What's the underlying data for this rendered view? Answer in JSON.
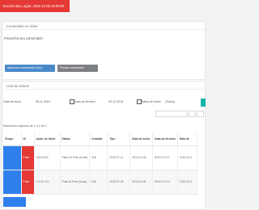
{
  "alert": {
    "text": "Vencido alvo, ação: 2015-12-05 10:00:00",
    "color": "#e53935"
  },
  "panel1": {
    "title": "Comentário no ticket",
    "content_text": "Preencha seu comentário"
  },
  "buttons": {
    "primary": "Adicionar comentário (Ctrl)",
    "secondary": "Fechar comentário"
  },
  "panel2": {
    "title": "Lista de tickets"
  },
  "filters": {
    "date_from_label": "Data de início",
    "date_from_value": "05.11.2015",
    "date_to_label": "Data de término",
    "date_to_value": "05.12.2015",
    "status_label": "Status de ticket",
    "status_value": "(Todos)"
  },
  "records_text": "Mostrando registros de 1 a 2 de 2",
  "table": {
    "headers": [
      "Grupo",
      "ID",
      "Autor do ticket",
      "Status",
      "Unidade",
      "Tipo",
      "Data de início",
      "Data de término",
      "Data de"
    ],
    "rows": [
      {
        "id": "Push",
        "author": "15012015",
        "status": "Plano di Push (trunk)",
        "unit": "N/A",
        "type": "2015-07-11",
        "start": "2015-12-08",
        "end": "BGS 0.0.0.0",
        "extra": "2015-12-0"
      },
      {
        "id": "Push",
        "author": "2.3.31.121",
        "status": "Push di Push (trunk)",
        "unit": "N/A",
        "type": "2015-07-09",
        "start": "2015-11-08",
        "end": "BGS 0.0.0.0",
        "extra": "2015-12-0"
      }
    ]
  },
  "colors": {
    "accent_blue": "#2f80ed",
    "teal": "#16b6a8",
    "red": "#e53935"
  }
}
